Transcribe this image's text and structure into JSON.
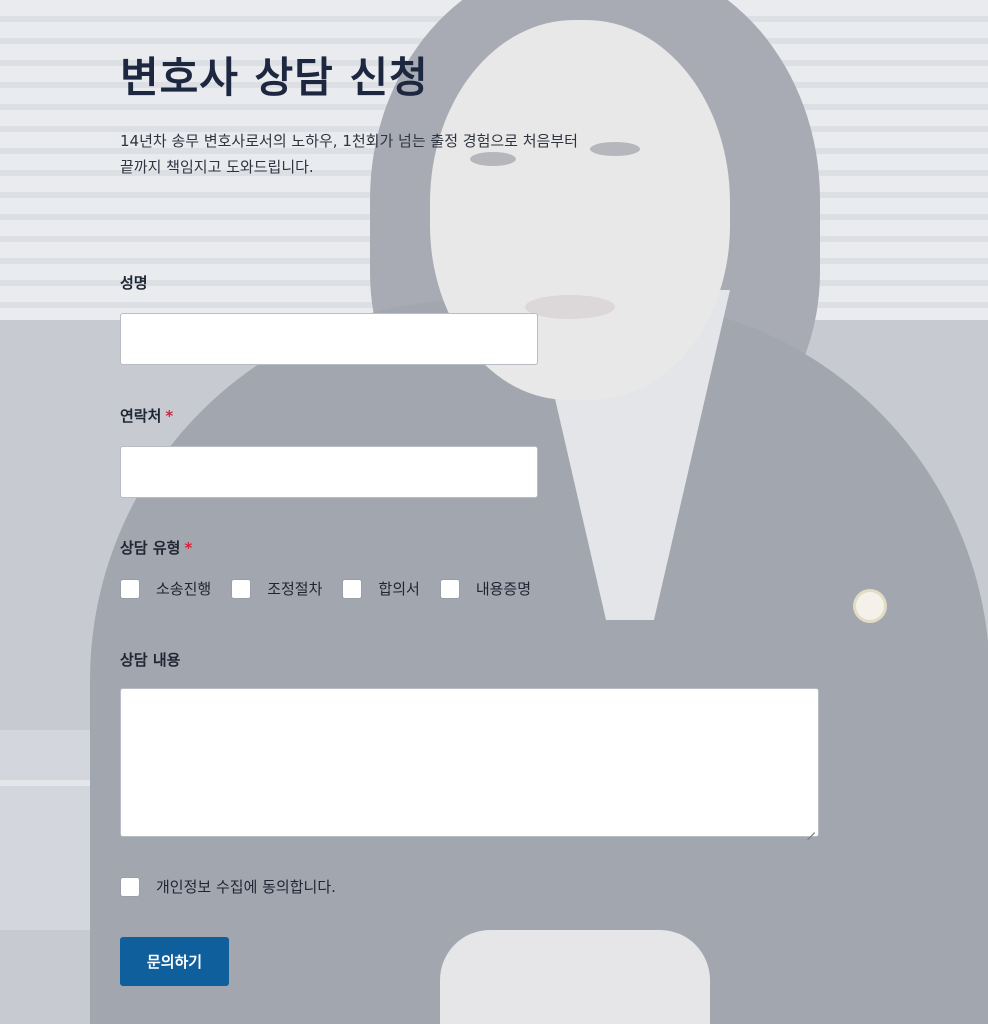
{
  "form": {
    "title": "변호사 상담 신청",
    "intro": "14년차 송무 변호사로서의 노하우, 1천회가 넘는 출정 경험으로 처음부터 끝까지 책임지고 도와드립니다.",
    "name_label": "성명",
    "contact_label": "연락처",
    "required_mark": "*",
    "type_label": "상담 유형",
    "type_options": [
      "소송진행",
      "조정절차",
      "합의서",
      "내용증명"
    ],
    "content_label": "상담 내용",
    "consent_label": "개인정보 수집에 동의합니다.",
    "submit_label": "문의하기"
  },
  "colors": {
    "title": "#1d2740",
    "required": "#d0263d",
    "button": "#0f5f9c"
  }
}
